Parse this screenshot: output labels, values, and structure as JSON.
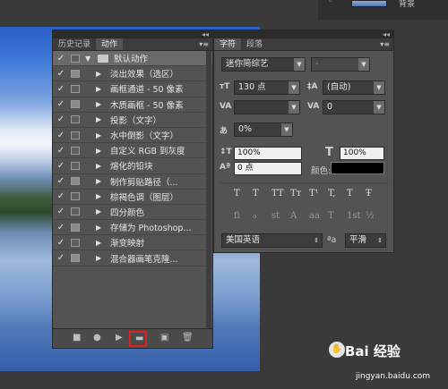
{
  "layers_strip": {
    "layer_name": "背景",
    "visibility_mark": "◦"
  },
  "actions_panel": {
    "collapse_glyph": "◂◂",
    "close_glyph": "✕",
    "tabs": [
      "历史记录",
      "动作"
    ],
    "menu_glyph": "▾≡",
    "set_name": "默认动作",
    "actions": [
      {
        "label": "淡出效果（选区）",
        "dialog": true
      },
      {
        "label": "画框通道 - 50 像素",
        "dialog": false
      },
      {
        "label": "木质画框 - 50 像素",
        "dialog": true
      },
      {
        "label": "投影（文字）",
        "dialog": false
      },
      {
        "label": "水中倒影（文字）",
        "dialog": false
      },
      {
        "label": "自定义 RGB 到灰度",
        "dialog": false
      },
      {
        "label": "熔化的铅块",
        "dialog": false
      },
      {
        "label": "制作剪贴路径（...",
        "dialog": true
      },
      {
        "label": "棕褐色调（图层）",
        "dialog": false
      },
      {
        "label": "四分颜色",
        "dialog": false
      },
      {
        "label": "存储为 Photoshop...",
        "dialog": true
      },
      {
        "label": "渐变映射",
        "dialog": false
      },
      {
        "label": "混合器画笔克隆...",
        "dialog": true
      }
    ],
    "bottom_icons": [
      "■",
      "●",
      "▶",
      "▬",
      "▣",
      "🗑"
    ]
  },
  "character_panel": {
    "collapse_glyph": "◂◂",
    "close_glyph": "✕",
    "tabs": [
      "字符",
      "段落"
    ],
    "menu_glyph": "▾≡",
    "font_family": "迷你简综艺",
    "font_style": "-",
    "font_size": "130 点",
    "leading": "(自动)",
    "kerning": "",
    "tracking": "0",
    "tsume": "0%",
    "vertical_scale": "100%",
    "horizontal_scale": "100%",
    "baseline_shift": "0 点",
    "color_label": "颜色:",
    "text_color": "#000000",
    "style_buttons": [
      "T",
      "T",
      "TT",
      "Tт",
      "T¹",
      "T,",
      "T",
      "Ŧ"
    ],
    "opentype_buttons": [
      "fi",
      "ℴ",
      "st",
      "A",
      "aa",
      "T",
      "1st",
      "½"
    ],
    "language": "美国英语",
    "aa_label": "ªa",
    "antialias": "平滑"
  },
  "watermark": {
    "brand": "Bai  经验",
    "url": "jingyan.baidu.com"
  }
}
